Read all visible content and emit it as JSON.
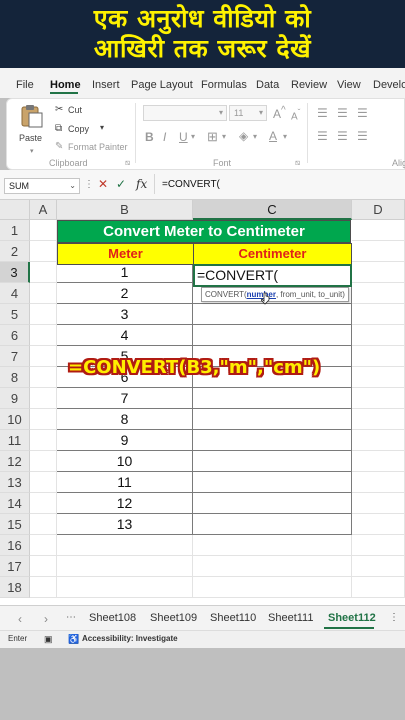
{
  "banner": {
    "line1": "एक अनुरोध वीडियो को",
    "line2": "आखिरी तक जरूर देखें"
  },
  "menu": [
    "File",
    "Home",
    "Insert",
    "Page Layout",
    "Formulas",
    "Data",
    "Review",
    "View",
    "Develo"
  ],
  "ribbon": {
    "paste": "Paste",
    "cut": "Cut",
    "copy": "Copy",
    "format_painter": "Format Painter",
    "clipboard": "Clipboard",
    "font_group": "Font",
    "font_size": "11",
    "bold": "B",
    "italic": "I",
    "underline": "U",
    "align_group": "Alig"
  },
  "formula_bar": {
    "name_box": "SUM",
    "fx": "fx",
    "formula": "=CONVERT("
  },
  "columns": [
    "A",
    "B",
    "C",
    "D"
  ],
  "rows": [
    "1",
    "2",
    "3",
    "4",
    "5",
    "6",
    "7",
    "8",
    "9",
    "10",
    "11",
    "12",
    "13",
    "14",
    "15",
    "16",
    "17",
    "18"
  ],
  "sheet": {
    "title": "Convert Meter to Centimeter",
    "header_meter": "Meter",
    "header_cm": "Centimeter",
    "meters": [
      "1",
      "2",
      "3",
      "4",
      "5",
      "6",
      "7",
      "8",
      "9",
      "10",
      "11",
      "12",
      "13"
    ],
    "active_text": "=CONVERT(",
    "tooltip_fn": "CONVERT(",
    "tooltip_arg": "number",
    "tooltip_rest": ", from_unit, to_unit)",
    "overlay_formula": "=CONVERT(B3,\"m\",\"cm\")"
  },
  "tabs": [
    "Sheet108",
    "Sheet109",
    "Sheet110",
    "Sheet111",
    "Sheet112"
  ],
  "active_tab": "Sheet112",
  "status": {
    "mode": "Enter",
    "accessibility": "Accessibility: Investigate"
  },
  "colors": {
    "banner_bg": "#14243a",
    "banner_text": "#fff200",
    "excel_green": "#217346",
    "title_green": "#00a74e",
    "header_yellow": "#ffff00",
    "header_red": "#e0211a"
  }
}
